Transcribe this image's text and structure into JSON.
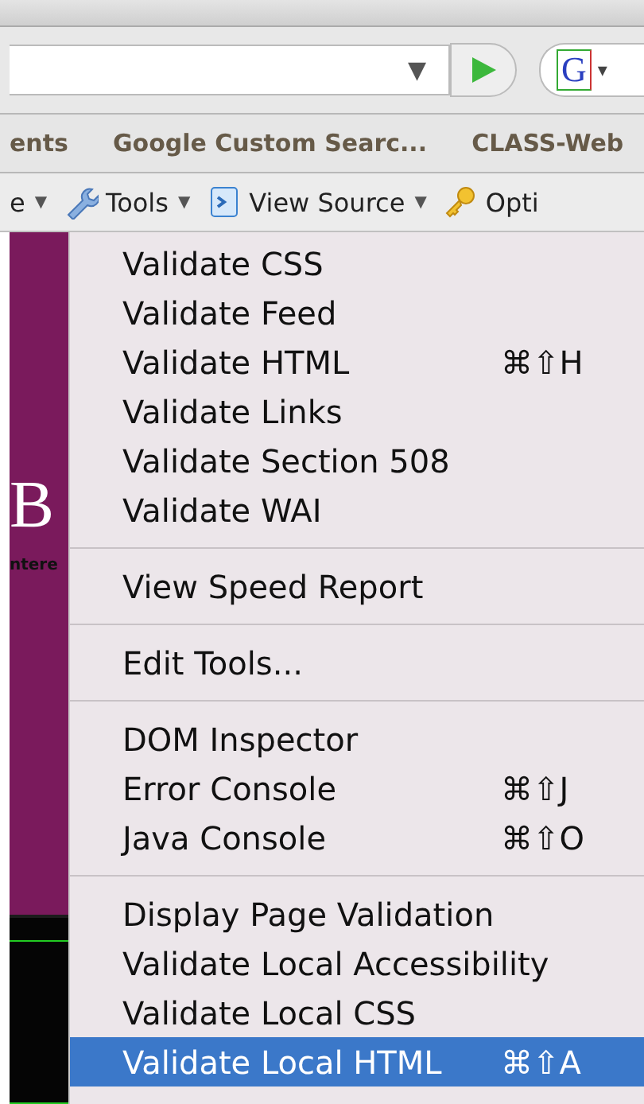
{
  "address_bar": {
    "dropdown": "▼"
  },
  "search_box": {
    "logo": "G",
    "dropdown": "▾"
  },
  "bookmarks": [
    "ents",
    "Google Custom Searc...",
    "CLASS-Web"
  ],
  "toolbar": [
    {
      "kind": "text",
      "label": "e",
      "caret": "▼"
    },
    {
      "kind": "wrench",
      "label": "Tools",
      "caret": "▼"
    },
    {
      "kind": "source",
      "label": "View Source",
      "caret": "▼"
    },
    {
      "kind": "key",
      "label": "Opti"
    }
  ],
  "page": {
    "heading": "B",
    "tagline": "ntere"
  },
  "menu": [
    {
      "kind": "item",
      "label": "Validate CSS",
      "selected": false
    },
    {
      "kind": "item",
      "label": "Validate Feed",
      "selected": false
    },
    {
      "kind": "item",
      "label": "Validate HTML",
      "shortcut": "⌘⇧H",
      "selected": false
    },
    {
      "kind": "item",
      "label": "Validate Links",
      "selected": false
    },
    {
      "kind": "item",
      "label": "Validate Section 508",
      "selected": false
    },
    {
      "kind": "item",
      "label": "Validate WAI",
      "selected": false
    },
    {
      "kind": "separator"
    },
    {
      "kind": "item",
      "label": "View Speed Report",
      "selected": false
    },
    {
      "kind": "separator"
    },
    {
      "kind": "item",
      "label": "Edit Tools...",
      "selected": false
    },
    {
      "kind": "separator"
    },
    {
      "kind": "item",
      "label": "DOM Inspector",
      "selected": false
    },
    {
      "kind": "item",
      "label": "Error Console",
      "shortcut": "⌘⇧J",
      "selected": false
    },
    {
      "kind": "item",
      "label": "Java Console",
      "shortcut": "⌘⇧O",
      "selected": false
    },
    {
      "kind": "separator"
    },
    {
      "kind": "item",
      "label": "Display Page Validation",
      "selected": false
    },
    {
      "kind": "item",
      "label": "Validate Local Accessibility",
      "selected": false
    },
    {
      "kind": "item",
      "label": "Validate Local CSS",
      "selected": false
    },
    {
      "kind": "item",
      "label": "Validate Local HTML",
      "shortcut": "⌘⇧A",
      "selected": true
    }
  ]
}
